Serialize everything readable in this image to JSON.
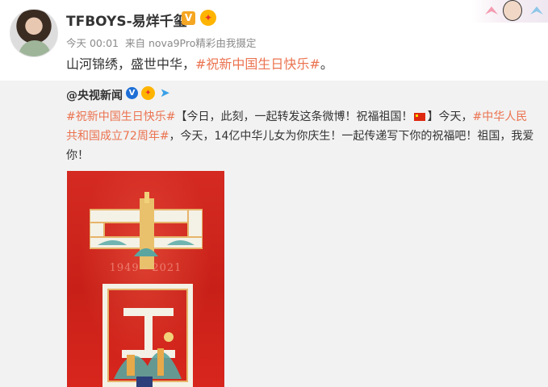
{
  "post": {
    "author": "TFBOYS-易烊千玺",
    "verified_badge": "V",
    "meta": {
      "time": "今天 00:01",
      "source": "来自 nova9Pro精彩由我摄定"
    },
    "text_plain": "山河锦绣，盛世中华，",
    "text_tag": "#祝新中国生日快乐#",
    "text_end": "。"
  },
  "repost": {
    "author": "@央视新闻",
    "verified_badge": "V",
    "seg1_tag": "#祝新中国生日快乐#",
    "seg2": "【今日，此刻，一起转发这条微博！祝福祖国！",
    "seg3": "】今天，",
    "seg4_tag": "#中华人民共和国成立72周年#",
    "seg5": "，今天，14亿中华儿女为你庆生！一起传递写下你的祝福吧！祖国，我爱你！",
    "poster": {
      "years": "1949 - 2021"
    }
  },
  "icons": [
    "medal-icon",
    "send-icon",
    "china-flag-icon"
  ],
  "colors": {
    "accent": "#eb7350",
    "repost_bg": "#f2f2f2",
    "poster_red": "#d42a22"
  }
}
